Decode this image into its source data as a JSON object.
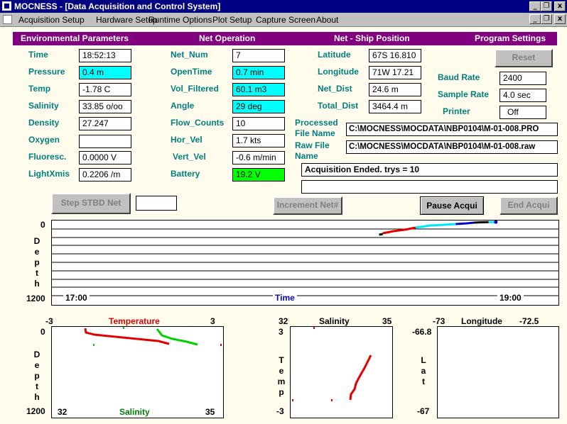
{
  "window": {
    "title": "MOCNESS - [Data Acquisition and Control System]",
    "min": "_",
    "restore": "❐",
    "close": "x"
  },
  "menu": [
    "Acquisition Setup",
    "Hardware Setup",
    "Runtime Options",
    "Plot Setup",
    "Capture Screen",
    "About"
  ],
  "headers": {
    "env": "Environmental Parameters",
    "net_op": "Net Operation",
    "position": "Net - Ship Position",
    "settings": "Program Settings"
  },
  "env": {
    "time": {
      "label": "Time",
      "value": "18:52:13"
    },
    "pressure": {
      "label": "Pressure",
      "value": "0.4 m"
    },
    "temp": {
      "label": "Temp",
      "value": "-1.78 C"
    },
    "salinity": {
      "label": "Salinity",
      "value": "33.85 o/oo"
    },
    "density": {
      "label": "Density",
      "value": "27.247"
    },
    "oxygen": {
      "label": "Oxygen",
      "value": ""
    },
    "fluoresc": {
      "label": "Fluoresc.",
      "value": "0.0000 V"
    },
    "lightxmis": {
      "label": "LightXmis",
      "value": "0.2206 /m"
    }
  },
  "net": {
    "net_num": {
      "label": "Net_Num",
      "value": "7"
    },
    "opentime": {
      "label": "OpenTime",
      "value": "0.7 min"
    },
    "vol_filtered": {
      "label": "Vol_Filtered",
      "value": "60.1 m3"
    },
    "angle": {
      "label": "Angle",
      "value": "29 deg"
    },
    "flow_counts": {
      "label": "Flow_Counts",
      "value": "10"
    },
    "hor_vel": {
      "label": "Hor_Vel",
      "value": "1.7 kts"
    },
    "vert_vel": {
      "label": "Vert_Vel",
      "value": "-0.6 m/min"
    },
    "battery": {
      "label": "Battery",
      "value": "19.2 V"
    }
  },
  "position": {
    "latitude": {
      "label": "Latitude",
      "value": "67S 16.810"
    },
    "longitude": {
      "label": "Longitude",
      "value": "71W 17.21"
    },
    "net_dist": {
      "label": "Net_Dist",
      "value": "24.6 m"
    },
    "total_dist": {
      "label": "Total_Dist",
      "value": "3464.4 m"
    }
  },
  "settings": {
    "reset": "Reset",
    "baud_rate": {
      "label": "Baud Rate",
      "value": "2400"
    },
    "sample_rate": {
      "label": "Sample Rate",
      "value": "4.0 sec"
    },
    "printer": {
      "label": "Printer",
      "value": "Off"
    }
  },
  "files": {
    "processed_label_1": "Processed",
    "processed_label_2": "File Name",
    "processed": "C:\\MOCNESS\\MOCDATA\\NBP0104\\M-01-008.PRO",
    "raw_label_1": "Raw File",
    "raw_label_2": "Name",
    "raw": "C:\\MOCNESS\\MOCDATA\\NBP0104\\M-01-008.raw"
  },
  "status": {
    "message": "Acquisition Ended. trys = 10",
    "message2": ""
  },
  "buttons": {
    "step": "Step STBD Net",
    "step_field": "",
    "increment": "Increment Net#",
    "pause": "Pause Acqui",
    "end": "End Acqui"
  },
  "time_plot": {
    "y_top": "0",
    "y_bottom": "1200",
    "ylabel": "Depth",
    "x_left": "17:00",
    "x_right": "19:00",
    "xlabel": "Time"
  },
  "temp_plot": {
    "t_min": "-3",
    "t_max": "3",
    "t_label": "Temperature",
    "y_top": "0",
    "y_bottom": "1200",
    "ylabel": "Depth",
    "s_min": "32",
    "s_max": "35",
    "s_label": "Salinity"
  },
  "ts_plot": {
    "x_min": "32",
    "x_max": "35",
    "xlabel": "Salinity",
    "y_top": "3",
    "y_bottom": "-3",
    "ylabel": "Temp"
  },
  "map_plot": {
    "x_min": "-73",
    "x_max": "-72.5",
    "xlabel": "Longitude",
    "y_top": "-66.8",
    "y_bottom": "-67",
    "ylabel": "Lat"
  },
  "colors": {
    "title": "#000082",
    "header": "#800080",
    "label": "#008080",
    "bg": "#fffcee",
    "cyan": "#00ffff",
    "green": "#00ff00",
    "red": "#e00000",
    "blue": "#0000c0"
  },
  "chart_data": [
    {
      "type": "scatter",
      "title": "",
      "xlabel": "Time",
      "ylabel": "Depth",
      "xlim": [
        "17:00",
        "19:00"
      ],
      "ylim": [
        1200,
        0
      ],
      "series": [
        {
          "color": "black",
          "x": [
            "18:27",
            "18:28"
          ],
          "y": [
            18,
            17
          ]
        },
        {
          "color": "red",
          "x": [
            "18:28",
            "18:31",
            "18:34",
            "18:37"
          ],
          "y": [
            16,
            13,
            11,
            8
          ]
        },
        {
          "color": "cyan",
          "x": [
            "18:37",
            "18:41",
            "18:45",
            "18:48"
          ],
          "y": [
            8,
            5,
            4,
            3
          ]
        },
        {
          "color": "blue",
          "x": [
            "18:48",
            "18:51",
            "18:53"
          ],
          "y": [
            3,
            2,
            1
          ]
        },
        {
          "color": "black",
          "x": [
            "18:53",
            "18:55",
            "18:57"
          ],
          "y": [
            1,
            0.5,
            0.3
          ]
        },
        {
          "color": "cyan",
          "x": [
            "18:57",
            "18:59"
          ],
          "y": [
            0.3,
            0.2
          ]
        },
        {
          "color": "blue",
          "x": [
            "18:59"
          ],
          "y": [
            0.1
          ]
        }
      ]
    }
  ]
}
